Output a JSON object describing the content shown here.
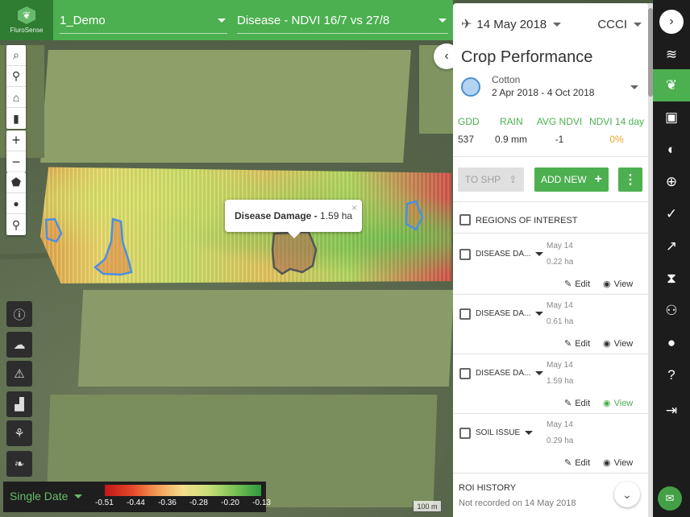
{
  "topbar": {
    "logo_text": "FluroSense",
    "farm_select": "1_Demo",
    "layer_select": "Disease - NDVI 16/7 vs 27/8"
  },
  "map_tools": [
    "search-icon",
    "pin-icon",
    "home-icon",
    "ruler-icon",
    "zoom-in-icon",
    "zoom-out-icon",
    "polygon-icon",
    "circle-icon",
    "marker-icon"
  ],
  "map_tool_glyphs": [
    "⌕",
    "⚲",
    "⌂",
    "▮",
    "+",
    "−",
    "⬟",
    "●",
    "⚲"
  ],
  "popup": {
    "title": "Disease Damage -",
    "value": "1.59 ha",
    "close": "×"
  },
  "legend": {
    "mode": "Single Date",
    "ticks": [
      "-0.51",
      "-0.44",
      "-0.36",
      "-0.28",
      "-0.20",
      "-0.13"
    ],
    "scale": "100 m"
  },
  "panel": {
    "date": "14 May 2018",
    "index": "CCCI",
    "title": "Crop Performance",
    "crop": "Cotton",
    "season": "2 Apr 2018 - 4 Oct 2018",
    "stats": [
      {
        "label": "GDD",
        "value": "537"
      },
      {
        "label": "RAIN",
        "value": "0.9 mm"
      },
      {
        "label": "AVG NDVI",
        "value": "-1"
      },
      {
        "label": "NDVI 14 day",
        "value": "0%"
      }
    ],
    "to_shp": "TO SHP",
    "add_new": "ADD NEW",
    "regions_header": "REGIONS OF INTEREST",
    "regions": [
      {
        "name": "DISEASE DA...",
        "date": "May 14",
        "area": "0.22 ha",
        "edit": "Edit",
        "view": "View",
        "view_active": false
      },
      {
        "name": "DISEASE DA...",
        "date": "May 14",
        "area": "0.61 ha",
        "edit": "Edit",
        "view": "View",
        "view_active": false
      },
      {
        "name": "DISEASE DA...",
        "date": "May 14",
        "area": "1.59 ha",
        "edit": "Edit",
        "view": "View",
        "view_active": true
      },
      {
        "name": "SOIL ISSUE",
        "date": "May 14",
        "area": "0.29 ha",
        "edit": "Edit",
        "view": "View",
        "view_active": false
      }
    ],
    "history_header": "ROI HISTORY",
    "history_text": "Not recorded on 14 May 2018"
  },
  "colors": {
    "accent": "#4caf50",
    "dark": "#1c1c1c",
    "orange": "#f4a623"
  }
}
